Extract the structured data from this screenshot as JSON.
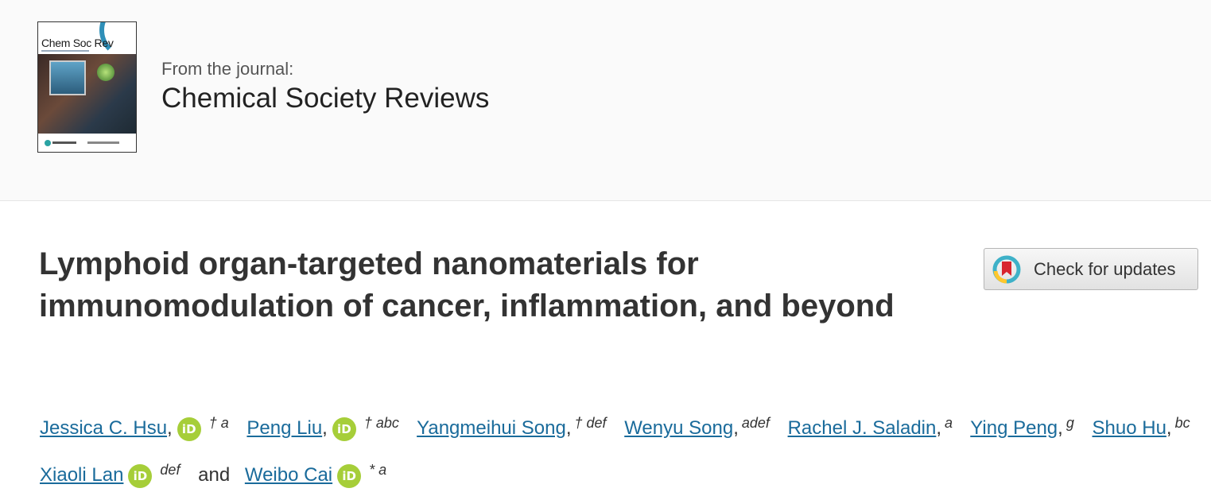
{
  "journal": {
    "cover_title": "Chem Soc Rev",
    "from_label": "From the journal:",
    "name": "Chemical Society Reviews"
  },
  "article": {
    "title": "Lymphoid organ-targeted nanomaterials for immunomodulation of cancer, inflammation, and beyond",
    "check_updates_label": "Check for updates"
  },
  "authors": [
    {
      "name": "Jessica C. Hsu",
      "orcid": true,
      "affil": "† a"
    },
    {
      "name": "Peng Liu",
      "orcid": true,
      "affil": "† abc"
    },
    {
      "name": "Yangmeihui Song",
      "orcid": false,
      "affil": "† def"
    },
    {
      "name": "Wenyu Song",
      "orcid": false,
      "affil": "adef"
    },
    {
      "name": "Rachel J. Saladin",
      "orcid": false,
      "affil": "a"
    },
    {
      "name": "Ying Peng",
      "orcid": false,
      "affil": "g"
    },
    {
      "name": "Shuo Hu",
      "orcid": false,
      "affil": "bc"
    },
    {
      "name": "Xiaoli Lan",
      "orcid": true,
      "affil": "def"
    },
    {
      "name": "Weibo Cai",
      "orcid": true,
      "affil": "* a"
    }
  ],
  "author_separator": ",",
  "author_conjunction": "and",
  "orcid_icon_text": "iD",
  "colors": {
    "link": "#1a6b9b",
    "orcid": "#a6ce39",
    "header_bg": "#fafafa"
  }
}
